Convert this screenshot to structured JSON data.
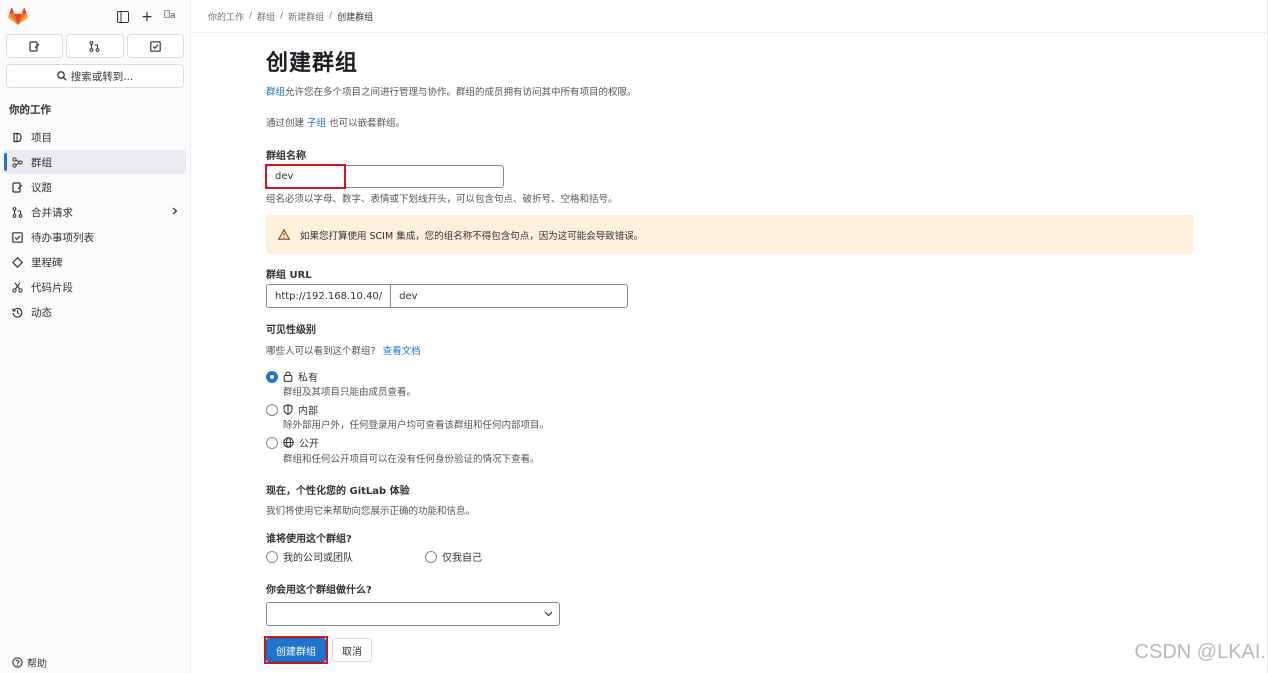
{
  "sidebar": {
    "avatar_alt": "a",
    "search_label": "搜索或转到...",
    "section_title": "你的工作",
    "items": [
      {
        "label": "项目",
        "icon": "project-icon"
      },
      {
        "label": "群组",
        "icon": "group-icon",
        "active": true
      },
      {
        "label": "议题",
        "icon": "issues-icon"
      },
      {
        "label": "合并请求",
        "icon": "merge-request-icon",
        "has_chevron": true
      },
      {
        "label": "待办事项列表",
        "icon": "todo-icon"
      },
      {
        "label": "里程碑",
        "icon": "milestone-icon"
      },
      {
        "label": "代码片段",
        "icon": "snippet-icon"
      },
      {
        "label": "动态",
        "icon": "history-icon"
      }
    ],
    "help_label": "帮助"
  },
  "breadcrumb": [
    "你的工作",
    "群组",
    "新建群组",
    "创建群组"
  ],
  "page": {
    "title": "创建群组",
    "desc_link": "群组",
    "desc_rest": "允许您在多个项目之间进行管理与协作。群组的成员拥有访问其中所有项目的权限。",
    "desc2_pre": "通过创建 ",
    "desc2_link": "子组",
    "desc2_post": " 也可以嵌套群组。",
    "name_label": "群组名称",
    "name_value": "dev",
    "name_hint": "组名必须以字母、数字、表情或下划线开头，可以包含句点、破折号、空格和括号。",
    "alert_text": "如果您打算使用 SCIM 集成，您的组名称不得包含句点，因为这可能会导致错误。",
    "url_label": "群组 URL",
    "url_prefix": "http://192.168.10.40/",
    "url_value": "dev",
    "visibility_label": "可见性级别",
    "visibility_question": "哪些人可以看到这个群组?",
    "visibility_doc_link": "查看文档",
    "visibility_options": [
      {
        "label": "私有",
        "desc": "群组及其项目只能由成员查看。",
        "icon": "lock-icon",
        "checked": true
      },
      {
        "label": "内部",
        "desc": "除外部用户外，任何登录用户均可查看该群组和任何内部项目。",
        "icon": "shield-icon",
        "checked": false
      },
      {
        "label": "公开",
        "desc": "群组和任何公开项目可以在没有任何身份验证的情况下查看。",
        "icon": "globe-icon",
        "checked": false
      }
    ],
    "personalize_title": "现在，个性化您的 GitLab 体验",
    "personalize_desc": "我们将使用它来帮助向您展示正确的功能和信息。",
    "who_label": "谁将使用这个群组?",
    "who_options": [
      "我的公司或团队",
      "仅我自己"
    ],
    "what_label": "你会用这个群组做什么?",
    "what_value": "",
    "create_button": "创建群组",
    "cancel_button": "取消"
  },
  "watermark": "CSDN @LKAI.",
  "colors": {
    "accent": "#1f75cb",
    "highlight_box": "#d2141c",
    "alert_bg": "#fdf1dd"
  }
}
